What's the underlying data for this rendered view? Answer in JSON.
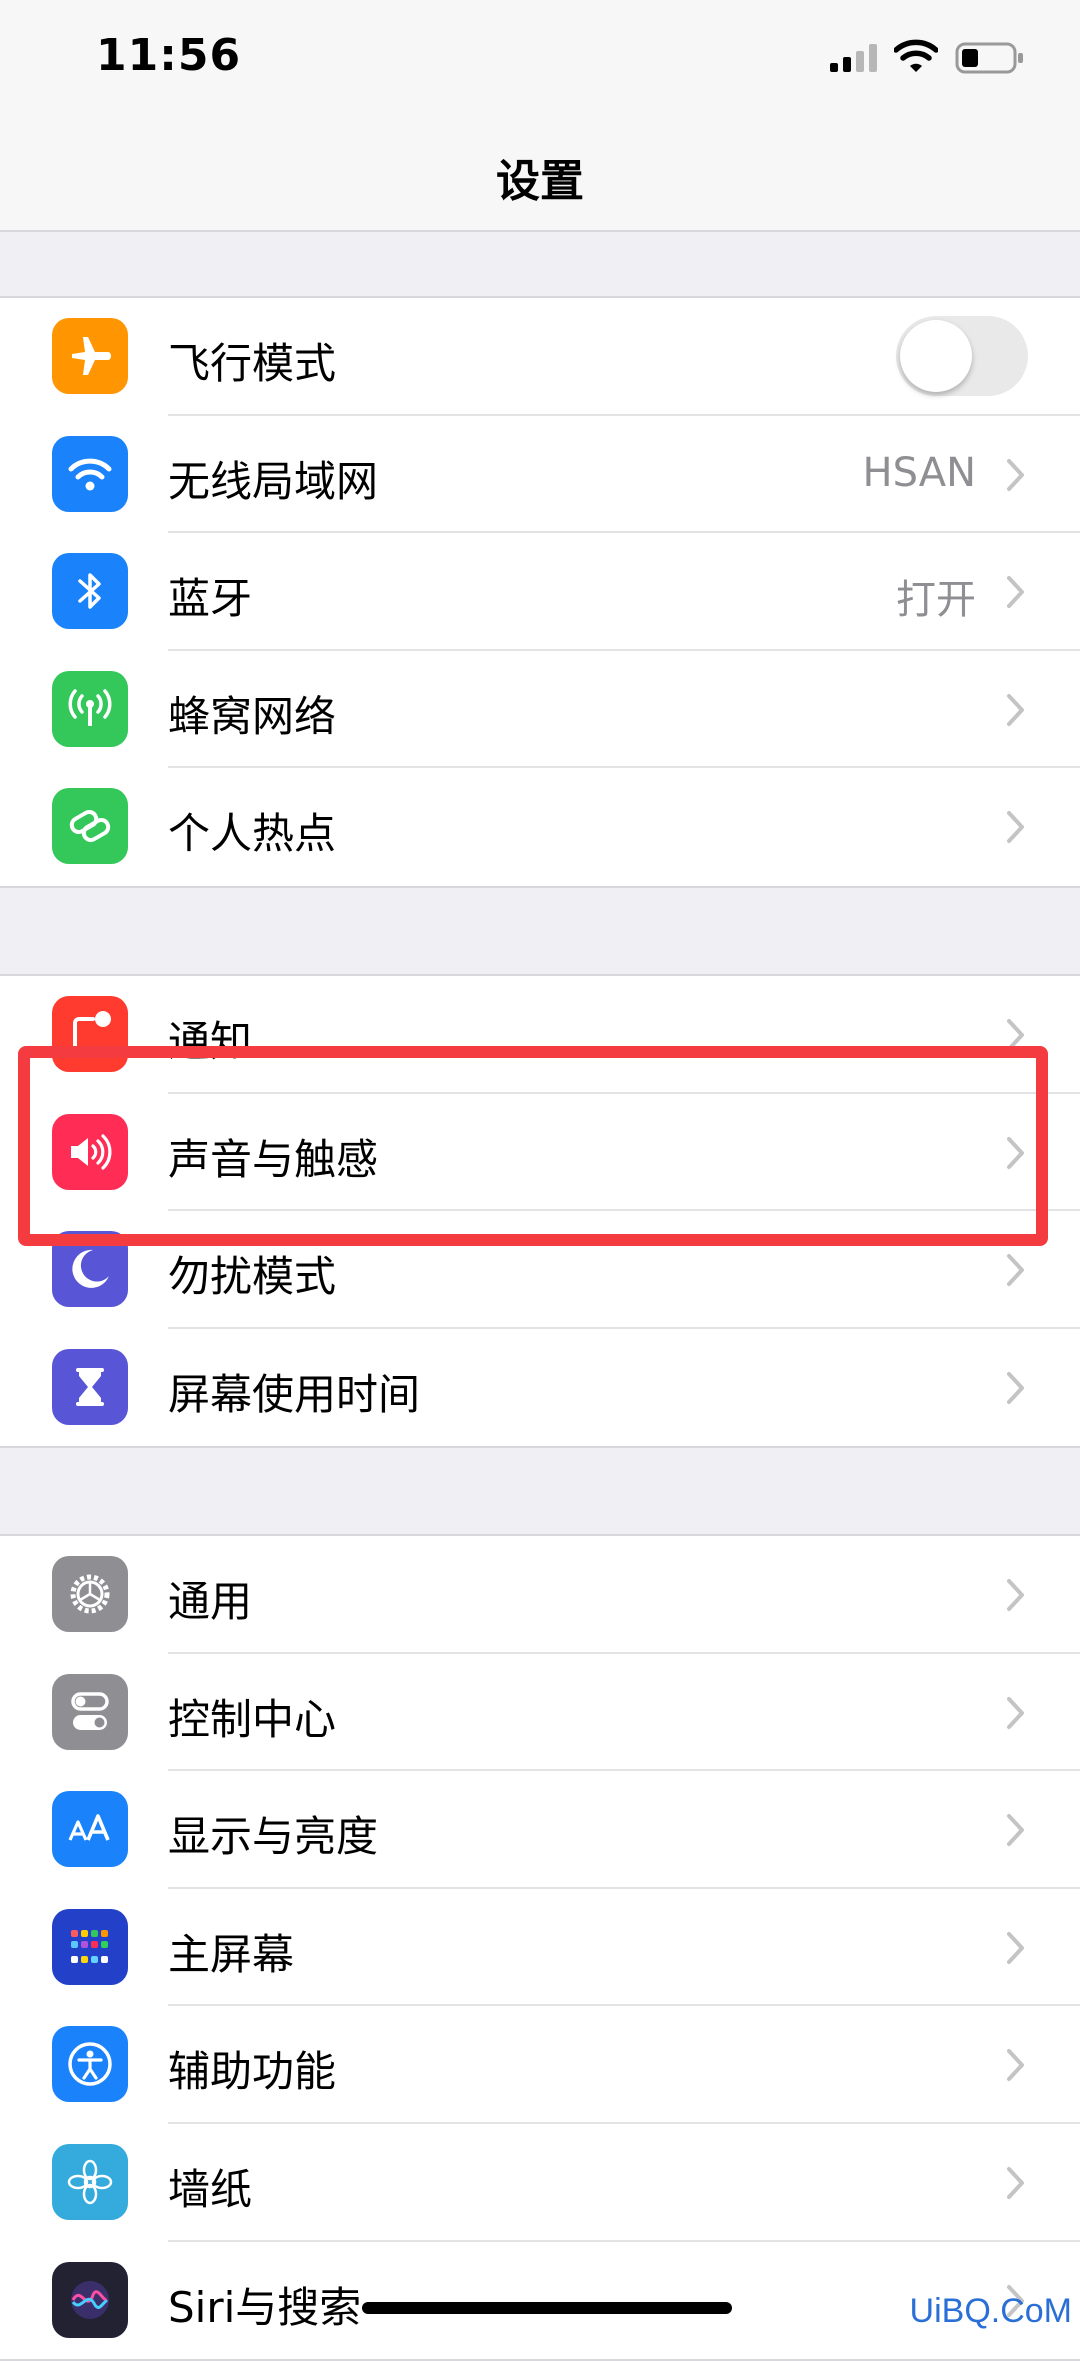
{
  "status_bar": {
    "time": "11:56"
  },
  "nav": {
    "title": "设置"
  },
  "groups": [
    {
      "rows": [
        {
          "label": "飞行模式",
          "icon": "airplane-icon",
          "color": "#ff9500",
          "toggle": false
        },
        {
          "label": "无线局域网",
          "icon": "wifi-icon",
          "color": "#1a82fb",
          "value": "HSAN"
        },
        {
          "label": "蓝牙",
          "icon": "bluetooth-icon",
          "color": "#1a82fb",
          "value": "打开"
        },
        {
          "label": "蜂窝网络",
          "icon": "cellular-antenna-icon",
          "color": "#34c759"
        },
        {
          "label": "个人热点",
          "icon": "hotspot-link-icon",
          "color": "#34c759"
        }
      ]
    },
    {
      "rows": [
        {
          "label": "通知",
          "icon": "notification-icon",
          "color": "#ff3b30"
        },
        {
          "label": "声音与触感",
          "icon": "speaker-icon",
          "color": "#ff2d55"
        },
        {
          "label": "勿扰模式",
          "icon": "moon-icon",
          "color": "#5856d6"
        },
        {
          "label": "屏幕使用时间",
          "icon": "hourglass-icon",
          "color": "#5856d6"
        }
      ]
    },
    {
      "rows": [
        {
          "label": "通用",
          "icon": "gear-icon",
          "color": "#8e8e93"
        },
        {
          "label": "控制中心",
          "icon": "switches-icon",
          "color": "#8e8e93"
        },
        {
          "label": "显示与亮度",
          "icon": "text-size-icon",
          "color": "#1a82fb"
        },
        {
          "label": "主屏幕",
          "icon": "home-screen-grid-icon",
          "color": "#2340c9"
        },
        {
          "label": "辅助功能",
          "icon": "accessibility-icon",
          "color": "#1a82fb"
        },
        {
          "label": "墙纸",
          "icon": "flower-icon",
          "color": "#35aadc"
        },
        {
          "label": "Siri与搜索",
          "icon": "siri-icon",
          "color": "#222233"
        }
      ]
    }
  ],
  "watermark": "UiBQ.CoM"
}
